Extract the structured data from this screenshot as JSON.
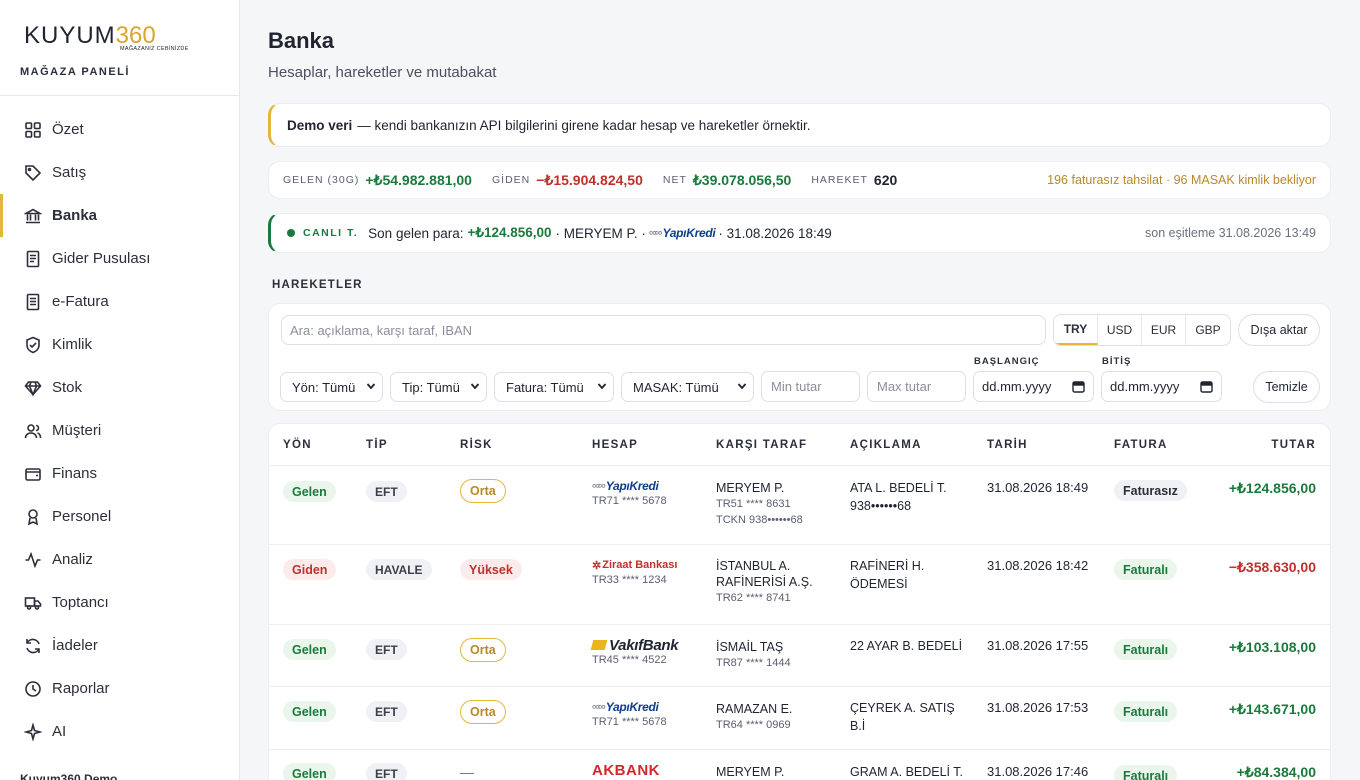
{
  "brand": {
    "logo_text": "KUYUM",
    "logo_num": "360",
    "logo_sub": "MAĞAZANIZ CEBİNİZDE",
    "panel_label": "MAĞAZA PANELİ"
  },
  "sidebar": {
    "items": [
      {
        "label": "Özet",
        "icon": "grid-icon"
      },
      {
        "label": "Satış",
        "icon": "tag-icon"
      },
      {
        "label": "Banka",
        "icon": "bank-icon",
        "active": true
      },
      {
        "label": "Gider Pusulası",
        "icon": "document-icon"
      },
      {
        "label": "e-Fatura",
        "icon": "invoice-icon"
      },
      {
        "label": "Kimlik",
        "icon": "shield-check-icon"
      },
      {
        "label": "Stok",
        "icon": "diamond-icon"
      },
      {
        "label": "Müşteri",
        "icon": "users-icon"
      },
      {
        "label": "Finans",
        "icon": "wallet-icon"
      },
      {
        "label": "Personel",
        "icon": "person-icon"
      },
      {
        "label": "Analiz",
        "icon": "activity-icon"
      },
      {
        "label": "Toptancı",
        "icon": "truck-icon"
      },
      {
        "label": "İadeler",
        "icon": "refresh-icon"
      },
      {
        "label": "Raporlar",
        "icon": "clock-icon"
      },
      {
        "label": "AI",
        "icon": "sparkle-icon"
      }
    ],
    "footer": "Kuyum360 Demo"
  },
  "header": {
    "title": "Banka",
    "subtitle": "Hesaplar, hareketler ve mutabakat"
  },
  "demo_notice": {
    "bold": "Demo veri",
    "text": "— kendi bankanızın API bilgilerini girene kadar hesap ve hareketler örnektir."
  },
  "stats": {
    "incoming_label": "GELEN (30G)",
    "incoming_value": "+₺54.982.881,00",
    "outgoing_label": "GİDEN",
    "outgoing_value": "−₺15.904.824,50",
    "net_label": "NET",
    "net_value": "₺39.078.056,50",
    "count_label": "HAREKET",
    "count_value": "620",
    "warning": "196 faturasız tahsilat · 96 MASAK kimlik bekliyor"
  },
  "live": {
    "label": "CANLI T.",
    "prefix": "Son gelen para:",
    "amount": "+₺124.856,00",
    "party": "· MERYEM P. ·",
    "bank": "YapıKredi",
    "datetime": "· 31.08.2026 18:49",
    "sync": "son eşitleme 31.08.2026 13:49"
  },
  "section_title": "HAREKETLER",
  "filters": {
    "search_placeholder": "Ara: açıklama, karşı taraf, IBAN",
    "currencies": [
      "TRY",
      "USD",
      "EUR",
      "GBP"
    ],
    "active_currency": "TRY",
    "export_label": "Dışa aktar",
    "direction": "Yön: Tümü",
    "type": "Tip: Tümü",
    "invoice": "Fatura: Tümü",
    "masak": "MASAK: Tümü",
    "min_placeholder": "Min tutar",
    "max_placeholder": "Max tutar",
    "start_label": "BAŞLANGIÇ",
    "end_label": "BİTİŞ",
    "date_placeholder": "dd.mm.yyyy",
    "clear_label": "Temizle"
  },
  "table": {
    "headers": [
      "YÖN",
      "TİP",
      "RİSK",
      "HESAP",
      "KARŞI TARAF",
      "AÇIKLAMA",
      "TARİH",
      "FATURA",
      "TUTAR"
    ],
    "rows": [
      {
        "dir": "Gelen",
        "type": "EFT",
        "risk": "Orta",
        "bank": "YapıKredi",
        "account": "TR71 **** 5678",
        "party": "MERYEM P.",
        "party_sub1": "TR51 **** 8631",
        "party_sub2": "TCKN 938••••••68",
        "desc1": "ATA L. BEDELİ T.",
        "desc2": "938••••••68",
        "date": "31.08.2026 18:49",
        "invoice": "Faturasız",
        "amount": "+₺124.856,00"
      },
      {
        "dir": "Giden",
        "type": "HAVALE",
        "risk": "Yüksek",
        "bank": "Ziraat Bankası",
        "account": "TR33 **** 1234",
        "party": "İSTANBUL A.",
        "party_line2": "RAFİNERİSİ A.Ş.",
        "party_sub1": "TR62 **** 8741",
        "desc1": "RAFİNERİ H.",
        "desc2": "ÖDEMESİ",
        "date": "31.08.2026 18:42",
        "invoice": "Faturalı",
        "amount": "−₺358.630,00"
      },
      {
        "dir": "Gelen",
        "type": "EFT",
        "risk": "Orta",
        "bank": "VakıfBank",
        "account": "TR45 **** 4522",
        "party": "İSMAİL TAŞ",
        "party_sub1": "TR87 **** 1444",
        "desc1": "22 AYAR B. BEDELİ",
        "date": "31.08.2026 17:55",
        "invoice": "Faturalı",
        "amount": "+₺103.108,00"
      },
      {
        "dir": "Gelen",
        "type": "EFT",
        "risk": "Orta",
        "bank": "YapıKredi",
        "account": "TR71 **** 5678",
        "party": "RAMAZAN E.",
        "party_sub1": "TR64 **** 0969",
        "desc1": "ÇEYREK A. SATIŞ",
        "desc2": "B.İ",
        "date": "31.08.2026 17:53",
        "invoice": "Faturalı",
        "amount": "+₺143.671,00"
      },
      {
        "dir": "Gelen",
        "type": "EFT",
        "risk": "—",
        "bank": "AKBANK",
        "party": "MERYEM P.",
        "desc1": "GRAM A. BEDELİ T.",
        "date": "31.08.2026 17:46",
        "invoice": "Faturalı",
        "amount": "+₺84.384,00"
      }
    ]
  },
  "colors": {
    "accent": "#e4b73c",
    "positive": "#1a7a3c",
    "negative": "#c0312b",
    "warning": "#b8892a"
  }
}
